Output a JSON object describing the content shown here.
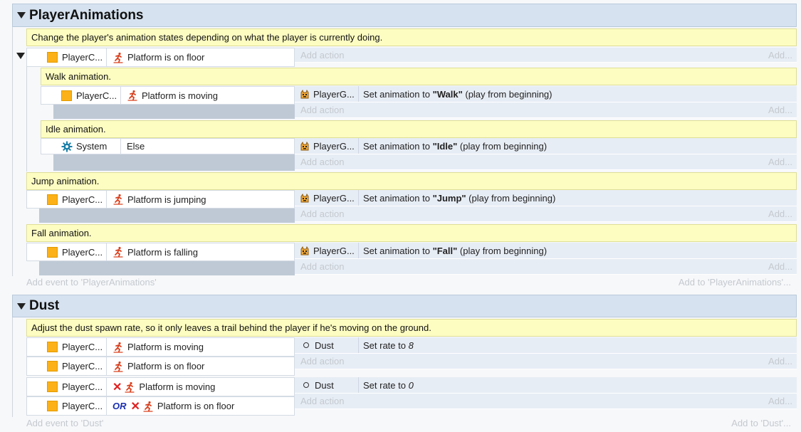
{
  "groups": {
    "player_animations": {
      "title": "PlayerAnimations",
      "comment": "Change the player's animation states depending on what the player is currently doing.",
      "add_event": "Add event to 'PlayerAnimations'",
      "add_to": "Add to 'PlayerAnimations'..."
    },
    "dust": {
      "title": "Dust",
      "comment": "Adjust the dust spawn rate, so it only leaves a trail behind the player if he's moving on the ground.",
      "add_event": "Add event to 'Dust'",
      "add_to": "Add to 'Dust'..."
    }
  },
  "common": {
    "add_action": "Add action",
    "add_more": "Add...",
    "set_animation_prefix": "Set animation to ",
    "play_from_beginning": " (play from beginning)",
    "set_rate_prefix": "Set rate to ",
    "or_label": "OR"
  },
  "events": {
    "on_floor": {
      "object": "PlayerC...",
      "condition": "Platform is on floor"
    },
    "walk": {
      "comment": "Walk animation.",
      "object": "PlayerC...",
      "condition": "Platform is moving",
      "action_object": "PlayerG...",
      "animation": "\"Walk\""
    },
    "idle": {
      "comment": "Idle animation.",
      "object": "System",
      "condition": "Else",
      "action_object": "PlayerG...",
      "animation": "\"Idle\""
    },
    "jump": {
      "comment": "Jump animation.",
      "object": "PlayerC...",
      "condition": "Platform is jumping",
      "action_object": "PlayerG...",
      "animation": "\"Jump\""
    },
    "fall": {
      "comment": "Fall animation.",
      "object": "PlayerC...",
      "condition": "Platform is falling",
      "action_object": "PlayerG...",
      "animation": "\"Fall\""
    },
    "dust_on": {
      "cond1_object": "PlayerC...",
      "cond1": "Platform is moving",
      "cond2_object": "PlayerC...",
      "cond2": "Platform is on floor",
      "action_object": "Dust",
      "rate": "8"
    },
    "dust_off": {
      "cond1_object": "PlayerC...",
      "cond1": "Platform is moving",
      "cond2_object": "PlayerC...",
      "cond2": "Platform is on floor",
      "action_object": "Dust",
      "rate": "0"
    }
  },
  "colors": {
    "group_header": "#d6e2ef",
    "comment": "#fdfdc2",
    "action_area": "#e7edf5",
    "object_icon": "#fbb117",
    "platform_icon": "#d9401e",
    "system_icon": "#1b7fa8"
  },
  "icons": {
    "object": "orange-square-icon",
    "platform": "running-man-icon",
    "system": "gear-icon",
    "sprite": "sprite-icon",
    "particles": "dot-icon",
    "invert": "x-mark-icon"
  }
}
